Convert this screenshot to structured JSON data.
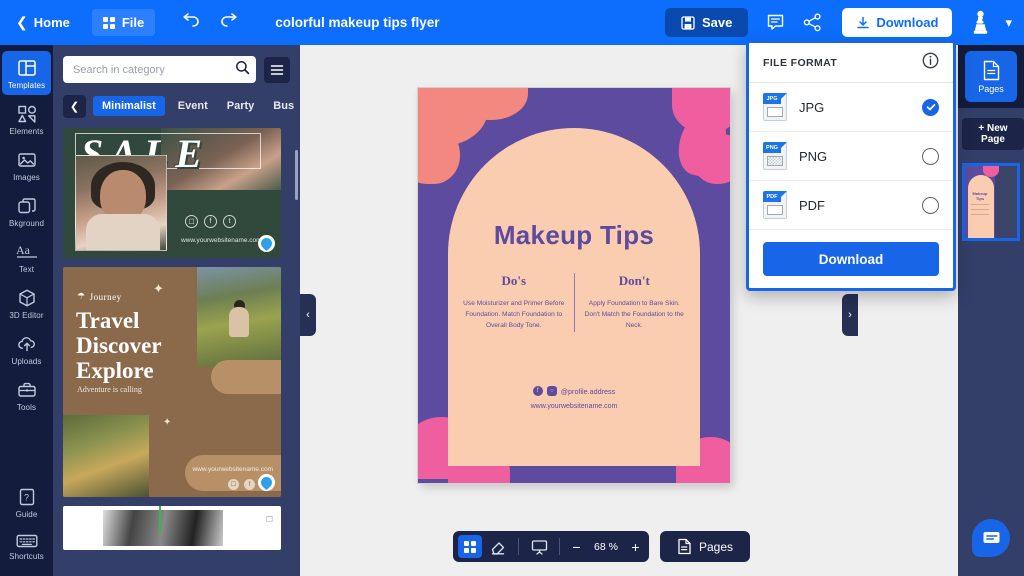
{
  "topbar": {
    "home_label": "Home",
    "file_label": "File",
    "doc_title": "colorful makeup tips flyer",
    "save_label": "Save",
    "download_label": "Download"
  },
  "rail": {
    "items": [
      {
        "label": "Templates",
        "icon": "templates-icon",
        "active": true
      },
      {
        "label": "Elements",
        "icon": "elements-icon",
        "active": false
      },
      {
        "label": "Images",
        "icon": "images-icon",
        "active": false
      },
      {
        "label": "Bkground",
        "icon": "background-icon",
        "active": false
      },
      {
        "label": "Text",
        "icon": "text-icon",
        "active": false
      },
      {
        "label": "3D Editor",
        "icon": "cube-icon",
        "active": false
      },
      {
        "label": "Uploads",
        "icon": "upload-cloud-icon",
        "active": false
      },
      {
        "label": "Tools",
        "icon": "toolbox-icon",
        "active": false
      }
    ],
    "bottom_items": [
      {
        "label": "Guide",
        "icon": "guide-icon"
      },
      {
        "label": "Shortcuts",
        "icon": "keyboard-icon"
      }
    ]
  },
  "panel": {
    "search_placeholder": "Search in category",
    "search_value": "",
    "categories": [
      "Minimalist",
      "Event",
      "Party",
      "Bus"
    ],
    "active_category": "Minimalist",
    "templates": [
      {
        "name": "sale-template",
        "title": "SALE",
        "url": "www.yourwebsitename.com",
        "socials": [
          "instagram",
          "facebook",
          "twitter"
        ]
      },
      {
        "name": "travel-template",
        "eyebrow": "Journey",
        "line1": "Travel",
        "line2": "Discover",
        "line3": "Explore",
        "subtitle": "Adventure is calling",
        "url": "www.yourwebsitename.com",
        "socials": [
          "instagram",
          "facebook",
          "twitter"
        ]
      },
      {
        "name": "third-template"
      }
    ]
  },
  "canvas": {
    "flyer": {
      "title": "Makeup Tips",
      "col_left_heading": "Do's",
      "col_left_body": "Use Moisturizer and Primer Before Foundation. Match Foundation to Overall Body Tone.",
      "col_right_heading": "Don't",
      "col_right_body": "Apply Foundation to Bare Skin. Don't Match the Foundation to the Neck.",
      "handle": "@profile.address",
      "url": "www.yourwebsitename.com",
      "colors": {
        "background": "#5c4b9e",
        "arch": "#fbcdb0",
        "petal_salmon": "#f2887f",
        "petal_pink": "#ef5fa0",
        "text": "#5c4b9e"
      }
    },
    "handle_left": "‹",
    "handle_right": "›"
  },
  "bottombar": {
    "zoom_value": "68 %",
    "zoom_out": "−",
    "zoom_in": "+",
    "pages_label": "Pages"
  },
  "right_panel": {
    "pages_label": "Pages",
    "new_page_label": "+ New Page",
    "thumb_title": "Makeup Tips"
  },
  "download_dropdown": {
    "header": "FILE FORMAT",
    "options": [
      {
        "label": "JPG",
        "tag": "JPG",
        "selected": true
      },
      {
        "label": "PNG",
        "tag": "PNG",
        "selected": false
      },
      {
        "label": "PDF",
        "tag": "PDF",
        "selected": false
      }
    ],
    "button_label": "Download"
  }
}
